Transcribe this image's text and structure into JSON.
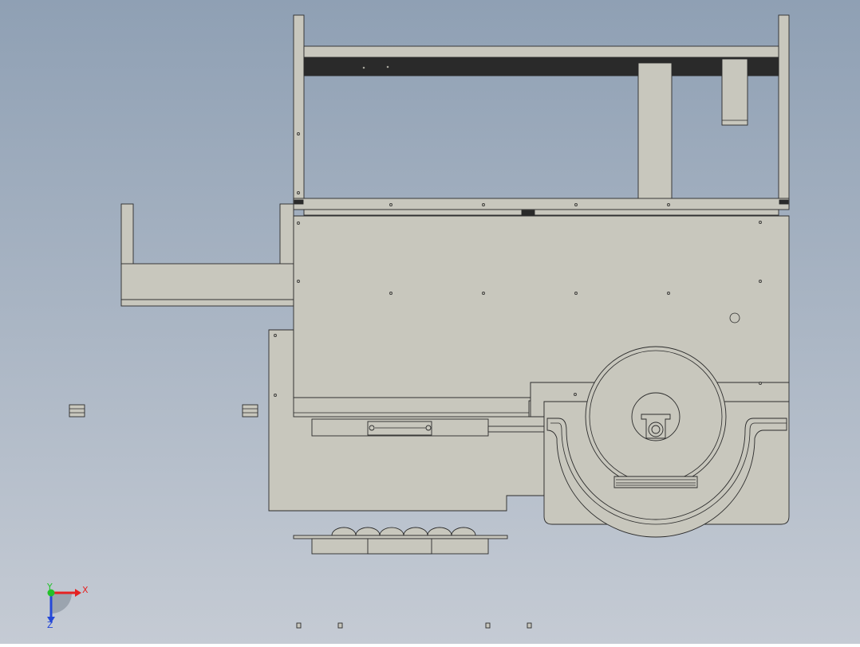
{
  "viewport": {
    "background_top": "#8fa0b4",
    "background_bottom": "#c5cbd4"
  },
  "part_colors": {
    "body": "#c8c7bd",
    "edge": "#2b2b2b",
    "dark_rail": "#2a2a2a",
    "shadow": "#a9a89e"
  },
  "triad": {
    "x_label": "X",
    "y_label": "Y",
    "z_label": "Z",
    "x_color": "#e52222",
    "y_color": "#22c22a",
    "z_color": "#2448d8"
  }
}
